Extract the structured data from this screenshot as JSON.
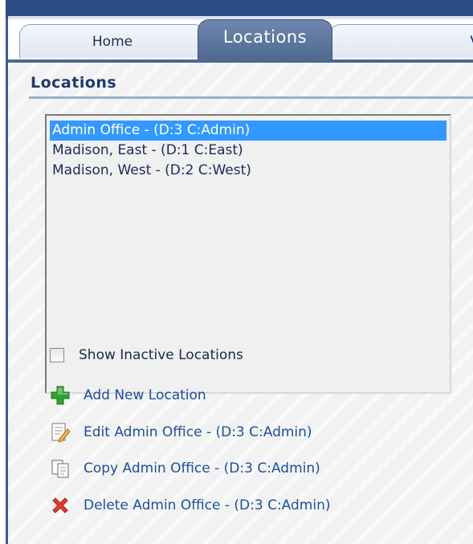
{
  "tabs": [
    {
      "label": "Home"
    },
    {
      "label": "Locations",
      "active": true
    },
    {
      "label": "V"
    }
  ],
  "section": {
    "title": "Locations"
  },
  "locations_list": {
    "options": [
      {
        "label": "Admin Office - (D:3 C:Admin)",
        "selected": true
      },
      {
        "label": "Madison, East - (D:1 C:East)",
        "selected": false
      },
      {
        "label": "Madison, West - (D:2 C:West)",
        "selected": false
      }
    ]
  },
  "show_inactive": {
    "label": "Show Inactive Locations",
    "checked": false
  },
  "actions": {
    "add": {
      "label": "Add New Location",
      "icon": "plus-icon"
    },
    "edit": {
      "label": "Edit Admin Office - (D:3 C:Admin)",
      "icon": "edit-icon"
    },
    "copy": {
      "label": "Copy Admin Office - (D:3 C:Admin)",
      "icon": "copy-icon"
    },
    "delete": {
      "label": "Delete Admin Office - (D:3 C:Admin)",
      "icon": "delete-icon"
    }
  },
  "colors": {
    "header": "#2c4d84",
    "active_tab": "#5d779e",
    "selection": "#3399ff",
    "link": "#1a4f9c"
  }
}
